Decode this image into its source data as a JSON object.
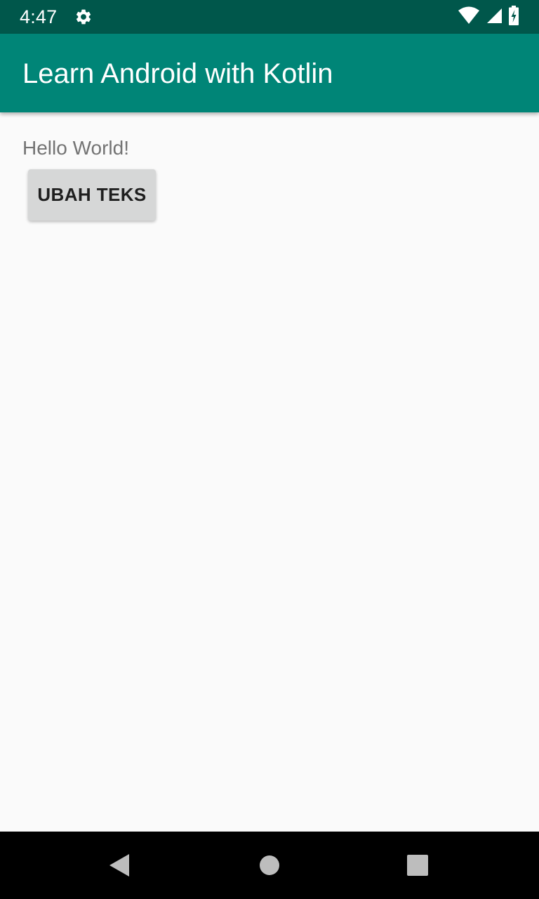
{
  "status_bar": {
    "time": "4:47",
    "icons": [
      "settings-gear-icon",
      "wifi-icon",
      "cell-signal-icon",
      "battery-charging-icon"
    ],
    "background": "#00574b"
  },
  "app_bar": {
    "title": "Learn Android with Kotlin",
    "background": "#008577"
  },
  "content": {
    "text": "Hello World!",
    "button_label": "UBAH TEKS"
  },
  "nav_bar": {
    "buttons": [
      "back-icon",
      "home-icon",
      "recents-icon"
    ]
  }
}
